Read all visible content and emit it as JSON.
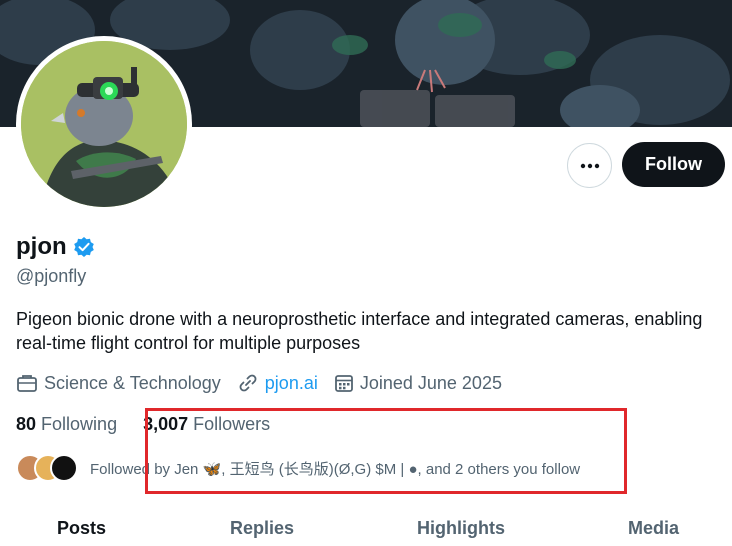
{
  "profile": {
    "display_name": "pjon",
    "handle": "@pjonfly",
    "bio": "Pigeon bionic drone with a neuroprosthetic interface and integrated cameras, enabling real-time flight control for multiple purposes",
    "verified_color": "#1d9bf0"
  },
  "actions": {
    "follow_label": "Follow",
    "more_icon": "more-horizontal-icon"
  },
  "meta": {
    "category": "Science & Technology",
    "website": "pjon.ai",
    "joined": "Joined June 2025"
  },
  "counts": {
    "following_num": "80",
    "following_label": "Following",
    "followers_num": "3,007",
    "followers_label": "Followers"
  },
  "followed_by": {
    "text": "Followed by Jen 🦋, 王短鸟 (长鸟版)(Ø,G) $M | ●, and 2 others you follow"
  },
  "tabs": [
    "Posts",
    "Replies",
    "Highlights",
    "Media"
  ],
  "colors": {
    "primary_text": "#0f1419",
    "secondary_text": "#536471",
    "accent": "#1d9bf0",
    "annotation_box": "#e0282b"
  }
}
